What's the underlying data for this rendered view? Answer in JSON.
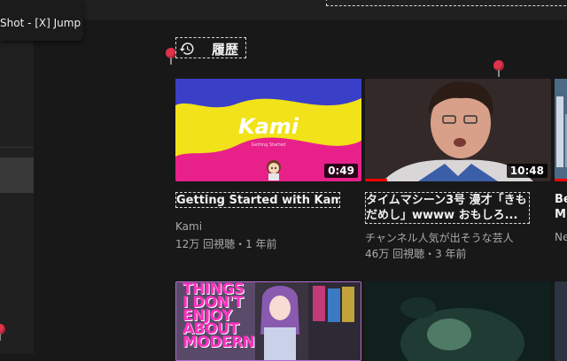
{
  "tooltip": {
    "text": "Shot - [X] Jump"
  },
  "section": {
    "title": "履歴",
    "icon": "history-icon"
  },
  "videos": [
    {
      "title": "Getting Started with Kami",
      "channel": "Kami",
      "meta": "12万 回視聴・1 年前",
      "duration": "0:49",
      "thumb_logo": "Kami",
      "thumb_sub": "Getting Started",
      "progress": 0.0
    },
    {
      "title": "タイムマシーン3号 漫才「きもだめし」wwww おもしろ...",
      "channel": "チャンネル人気が出そうな芸人",
      "meta": "46万 回視聴・3 年前",
      "duration": "10:48",
      "progress": 0.12
    }
  ],
  "partial": {
    "title_line1": "Be",
    "title_line2": "M",
    "channel": "Ne"
  },
  "bottom": {
    "thumb1_text": "THINGS\nI DON'T\nENJOY\nABOUT\nMODERN"
  },
  "colors": {
    "background": "#181818",
    "accent": "#ff0000",
    "pin": "#e0324b"
  }
}
